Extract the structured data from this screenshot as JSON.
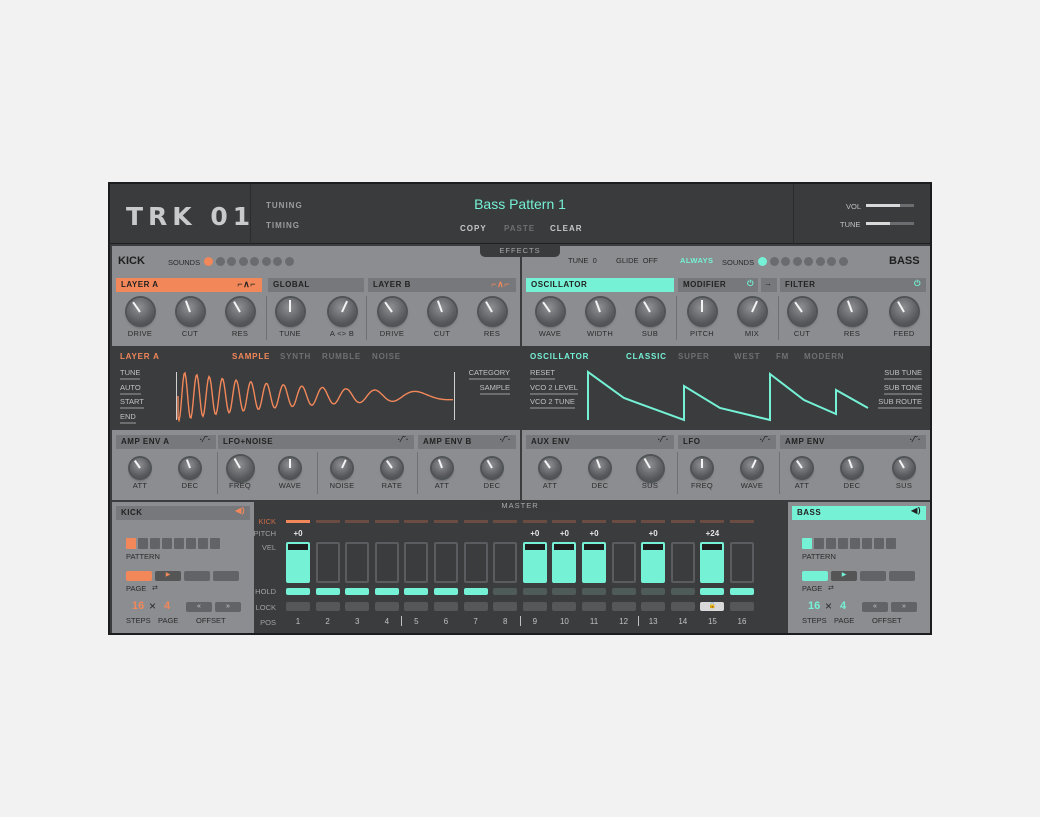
{
  "header": {
    "logo": "TRK 01",
    "nav": [
      "TUNING",
      "TIMING"
    ],
    "preset": "Bass Pattern 1",
    "actions": [
      "COPY",
      "PASTE",
      "CLEAR"
    ],
    "vol_label": "VOL",
    "tune_label": "TUNE",
    "vol_level": 0.7,
    "tune_level": 0.5
  },
  "effects_tab": "EFFECTS",
  "master_tab": "MASTER",
  "kick": {
    "title": "KICK",
    "sounds_label": "SOUNDS",
    "sounds_count": 8,
    "sounds_selected": 0,
    "layer_a": "LAYER A",
    "global": "GLOBAL",
    "layer_b": "LAYER B",
    "knobs": [
      "DRIVE",
      "CUT",
      "RES",
      "TUNE",
      "A <> B",
      "DRIVE",
      "CUT",
      "RES"
    ],
    "editor_title": "LAYER A",
    "modes": [
      "SAMPLE",
      "SYNTH",
      "RUMBLE",
      "NOISE"
    ],
    "left_params": [
      "TUNE",
      "AUTO",
      "START",
      "END"
    ],
    "right_params": [
      "CATEGORY",
      "SAMPLE"
    ],
    "env_headers": [
      "AMP ENV A",
      "LFO+NOISE",
      "AMP ENV B"
    ],
    "env_knobs": [
      "ATT",
      "DEC",
      "FREQ",
      "WAVE",
      "NOISE",
      "RATE",
      "ATT",
      "DEC"
    ]
  },
  "bass": {
    "title": "BASS",
    "tune_label": "TUNE",
    "tune_value": "0",
    "glide_label": "GLIDE",
    "glide_value": "OFF",
    "always": "ALWAYS",
    "sounds_label": "SOUNDS",
    "sounds_count": 8,
    "sounds_selected": 0,
    "oscillator": "OSCILLATOR",
    "modifier": "MODIFIER",
    "filter": "FILTER",
    "knobs": [
      "WAVE",
      "WIDTH",
      "SUB",
      "PITCH",
      "MIX",
      "CUT",
      "RES",
      "FEED"
    ],
    "editor_title": "OSCILLATOR",
    "modes": [
      "CLASSIC",
      "SUPER",
      "WEST",
      "FM",
      "MODERN"
    ],
    "left_params": [
      "RESET",
      "VCO 2 LEVEL",
      "VCO 2 TUNE"
    ],
    "right_params": [
      "SUB TUNE",
      "SUB TONE",
      "SUB ROUTE"
    ],
    "env_headers": [
      "AUX ENV",
      "LFO",
      "AMP ENV"
    ],
    "env_knobs": [
      "ATT",
      "DEC",
      "SUS",
      "FREQ",
      "WAVE",
      "ATT",
      "DEC",
      "SUS"
    ]
  },
  "seq_left": {
    "title": "KICK",
    "pattern": "PATTERN",
    "page": "PAGE",
    "steps_value": "16",
    "page_value": "4",
    "times": "×",
    "steps_label": "STEPS",
    "page_label": "PAGE",
    "offset_label": "OFFSET"
  },
  "seq_right": {
    "title": "BASS",
    "pattern": "PATTERN",
    "page": "PAGE",
    "steps_value": "16",
    "page_value": "4",
    "times": "×",
    "steps_label": "STEPS",
    "page_label": "PAGE",
    "offset_label": "OFFSET"
  },
  "sequencer": {
    "row_labels": [
      "KICK",
      "PITCH",
      "VEL",
      "HOLD",
      "LOCK",
      "POS"
    ],
    "positions": [
      "1",
      "2",
      "3",
      "4",
      "5",
      "6",
      "7",
      "8",
      "9",
      "10",
      "11",
      "12",
      "13",
      "14",
      "15",
      "16"
    ],
    "pitch": [
      "+0",
      "",
      "",
      "",
      "",
      "",
      "",
      "",
      "+0",
      "+0",
      "+0",
      "",
      "+0",
      "",
      "+24",
      ""
    ],
    "vel_active": [
      1,
      0,
      0,
      0,
      0,
      0,
      0,
      0,
      1,
      1,
      1,
      0,
      1,
      0,
      1,
      0
    ],
    "hold_active": [
      1,
      1,
      1,
      1,
      1,
      1,
      1,
      0,
      0,
      0,
      0,
      0,
      0,
      0,
      1,
      1
    ],
    "lock_icon_step": "15"
  },
  "colors": {
    "orange": "#f2885a",
    "mint": "#75f2d6"
  }
}
